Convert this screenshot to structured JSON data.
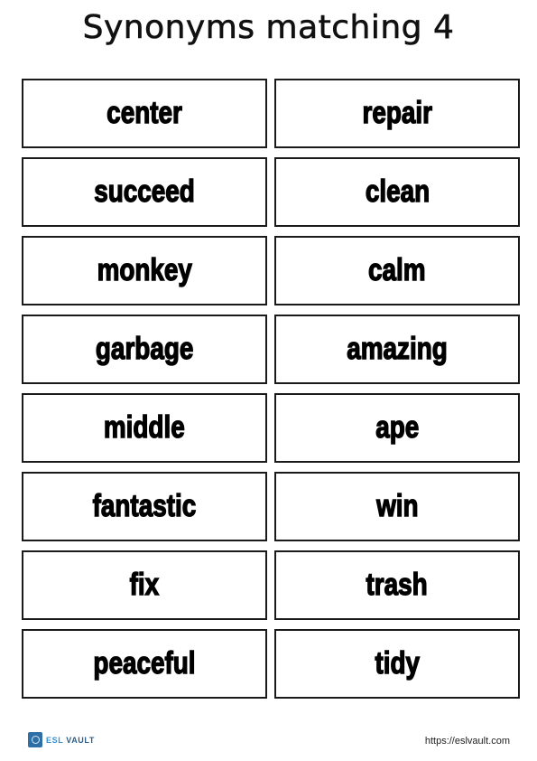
{
  "title": "Synonyms matching 4",
  "cards": {
    "left": [
      "center",
      "succeed",
      "monkey",
      "garbage",
      "middle",
      "fantastic",
      "fix",
      "peaceful"
    ],
    "right": [
      "repair",
      "clean",
      "calm",
      "amazing",
      "ape",
      "win",
      "trash",
      "tidy"
    ]
  },
  "footer": {
    "logo_icon": "vault-gear-icon",
    "logo_esl": "ESL",
    "logo_vault": "VAULT",
    "url": "https://eslvault.com"
  },
  "colors": {
    "logo_blue": "#2f6fa8",
    "border": "#1a1a1a"
  }
}
